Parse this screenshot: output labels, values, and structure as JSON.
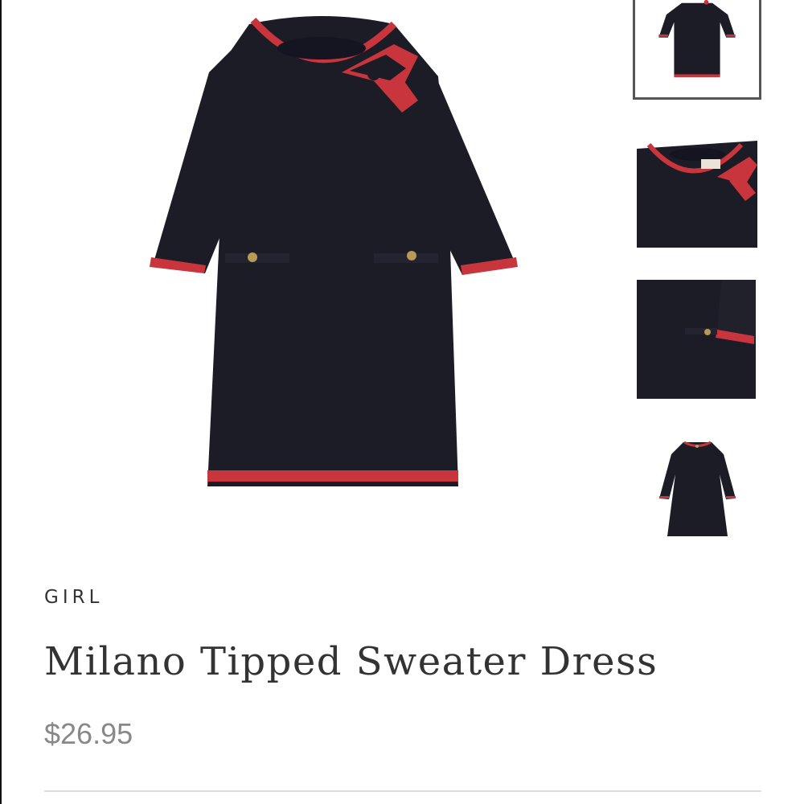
{
  "product": {
    "category": "GIRL",
    "name": "Milano Tipped Sweater Dress",
    "price": "$26.95"
  },
  "main_image": {
    "subject": "navy sweater dress with red tipping and bow"
  },
  "thumbnails": [
    {
      "label": "front",
      "selected": true
    },
    {
      "label": "collar-bow-detail",
      "selected": false
    },
    {
      "label": "sleeve-detail",
      "selected": false
    },
    {
      "label": "back",
      "selected": false
    }
  ],
  "colors": {
    "dress": "#1b1c26",
    "tipping": "#c8353d",
    "button": "#b69a55",
    "text": "#333333",
    "price": "#888888",
    "divider": "#dddddd",
    "thumb_border": "#555555"
  }
}
